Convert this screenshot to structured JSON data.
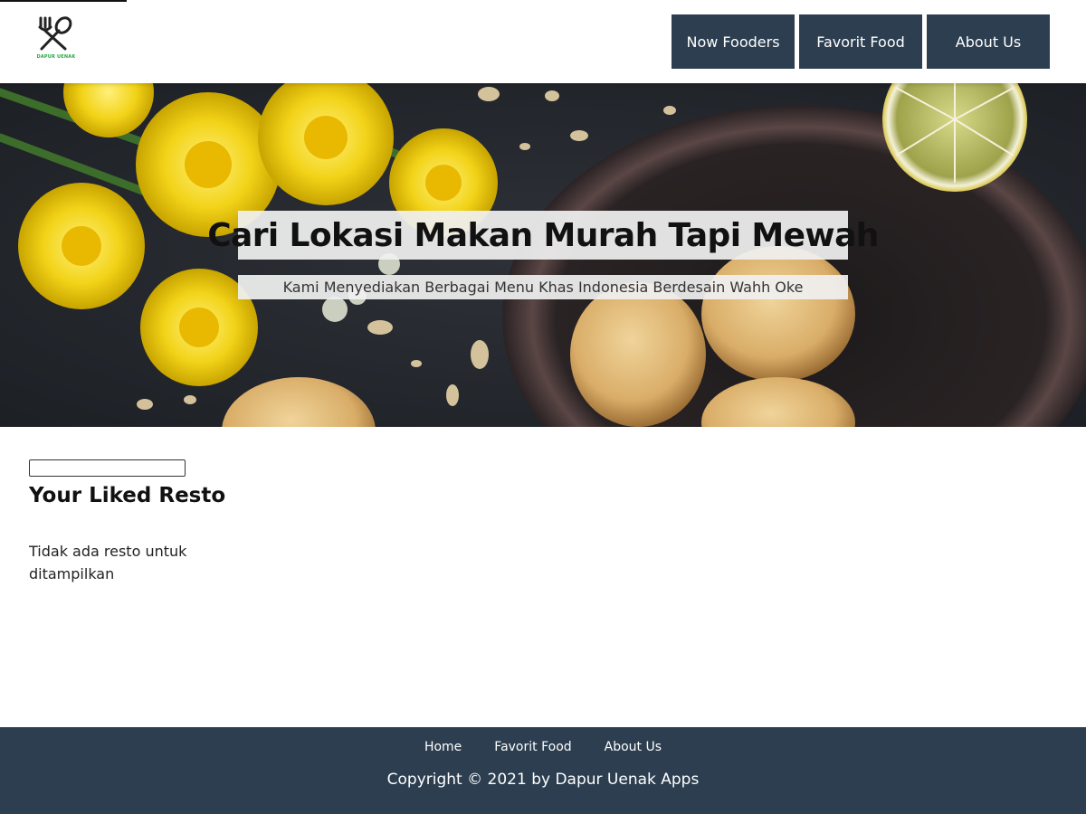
{
  "header": {
    "logo_text": "DAPUR UENAK",
    "nav": [
      "Now Fooders",
      "Favorit Food",
      "About Us"
    ]
  },
  "hero": {
    "title": "Cari Lokasi Makan Murah Tapi Mewah",
    "subtitle": "Kami Menyediakan Berbagai Menu Khas Indonesia Berdesain Wahh Oke"
  },
  "main": {
    "search": {
      "value": "",
      "placeholder": ""
    },
    "section_title": "Your Liked Resto",
    "empty_message": "Tidak ada resto untuk ditampilkan"
  },
  "footer": {
    "links": [
      "Home",
      "Favorit Food",
      "About Us"
    ],
    "copyright": "Copyright © 2021 by Dapur Uenak Apps"
  },
  "colors": {
    "nav_bg": "#2c3e50",
    "footer_bg": "#2c3e50",
    "logo_accent": "#28a745"
  },
  "icons": {
    "logo": "fork-spoon-icon"
  }
}
